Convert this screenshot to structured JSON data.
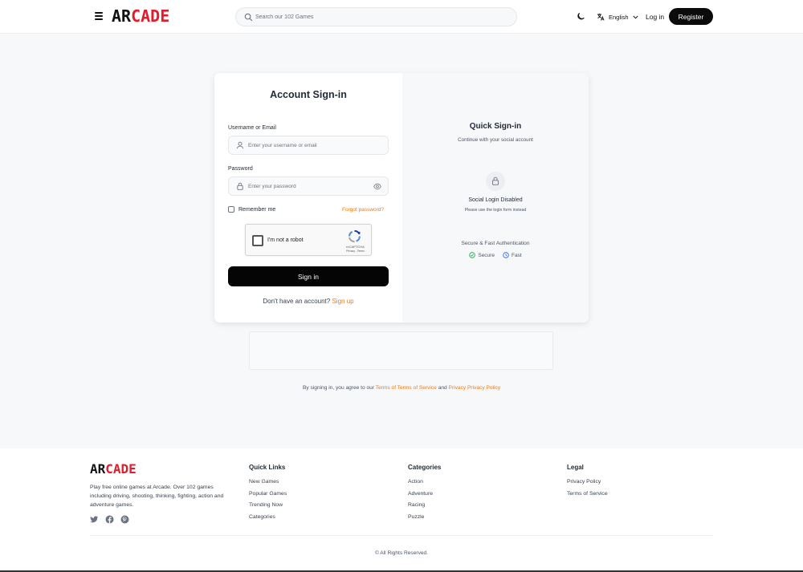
{
  "header": {
    "logo_part1": "AR",
    "logo_part2": "CADE",
    "search_placeholder": "Search our 102 Games",
    "language": "English",
    "login_label": "Log in",
    "register_label": "Register",
    "icons": [
      "menu-icon",
      "search-icon",
      "moon-icon",
      "translate-icon",
      "chevron-down-icon"
    ]
  },
  "signin": {
    "title": "Account Sign-in",
    "username_label": "Username or Email",
    "username_placeholder": "Enter your username or email",
    "password_label": "Password",
    "password_placeholder": "Enter your password",
    "remember_label": "Remember me",
    "forgot_label": "Forgot password?",
    "recaptcha_text": "I'm not a robot",
    "recaptcha_brand": "reCAPTCHA",
    "recaptcha_privacy": "Privacy - Terms",
    "submit_label": "Sign in",
    "no_account_text": "Don't have an account?",
    "signup_label": "Sign up"
  },
  "quick": {
    "title": "Quick Sign-in",
    "subtitle": "Continue with your social account",
    "disabled_title": "Social Login Disabled",
    "disabled_sub": "Please use the login form instead",
    "secure_title": "Secure & Fast Authentication",
    "badge_secure": "Secure",
    "badge_fast": "Fast"
  },
  "agreement": {
    "prefix": "By signing in, you agree to our",
    "terms": "Terms of Terms of Service",
    "and": "and",
    "privacy": "Privacy Privacy Policy"
  },
  "footer": {
    "logo_part1": "AR",
    "logo_part2": "CADE",
    "description": "Play free online games at Arcade. Over 102 games including driving, shooting, thinking, fighting, action and adventure games.",
    "quick_links": {
      "heading": "Quick Links",
      "items": [
        "New Games",
        "Popular Games",
        "Trending Now",
        "Categories"
      ]
    },
    "categories": {
      "heading": "Categories",
      "items": [
        "Action",
        "Adventure",
        "Racing",
        "Puzzle"
      ]
    },
    "legal": {
      "heading": "Legal",
      "items": [
        "Privacy Policy",
        "Terms of Service"
      ]
    },
    "copyright": "© All Rights Reserved."
  },
  "colors": {
    "accent": "#ea7a1c",
    "brand_red": "#e11d2b",
    "button_dark": "#050505"
  }
}
